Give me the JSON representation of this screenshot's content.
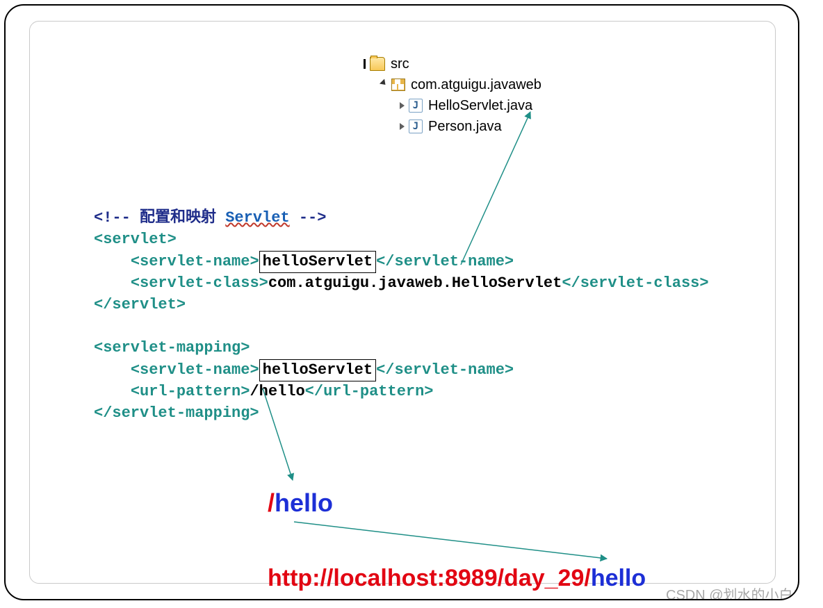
{
  "tree": {
    "src": "src",
    "pkg": "com.atguigu.javaweb",
    "file1": "HelloServlet.java",
    "file2": "Person.java"
  },
  "xml": {
    "comment_open": "<!-- ",
    "comment_text_cn": "配置和映射",
    "comment_kw": "Servlet",
    "comment_close": " -->",
    "servlet_open": "<servlet>",
    "servlet_close": "</servlet>",
    "servlet_name_open": "<servlet-name>",
    "servlet_name_close": "</servlet-name>",
    "servlet_class_open": "<servlet-class>",
    "servlet_class_close": "</servlet-class>",
    "servlet_mapping_open": "<servlet-mapping>",
    "servlet_mapping_close": "</servlet-mapping>",
    "url_pattern_open": "<url-pattern>",
    "url_pattern_close": "</url-pattern>",
    "name_value": "helloServlet",
    "class_value": "com.atguigu.javaweb.HelloServlet",
    "url_value": "/hello"
  },
  "annotation": {
    "slash": "/",
    "hello": "hello",
    "url_prefix": "http://localhost:8989/day_29/",
    "url_suffix": "hello"
  },
  "watermark": "CSDN @划水的小白白"
}
